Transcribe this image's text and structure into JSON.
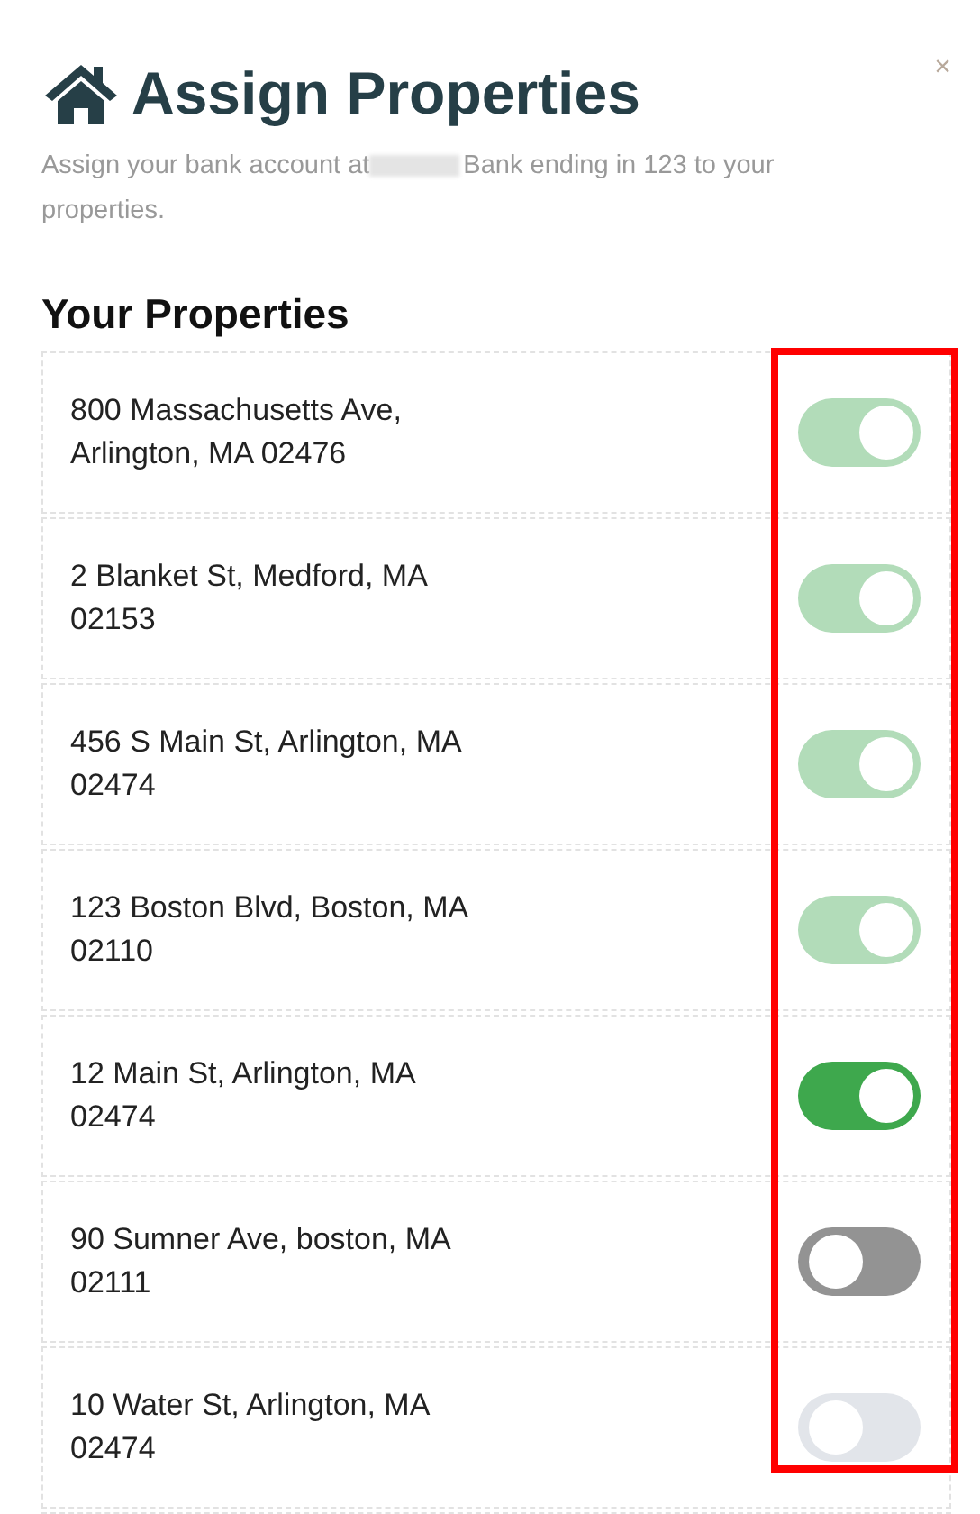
{
  "dialog": {
    "title": "Assign Properties",
    "close": "×",
    "subtitle_before": "Assign your bank account at",
    "subtitle_after": "Bank ending in 123 to your",
    "subtitle_end": "properties.",
    "redacted": true
  },
  "section_title": "Your Properties",
  "properties": [
    {
      "address": "800 Massachusetts Ave, Arlington, MA 02476",
      "on": true,
      "disabled": true
    },
    {
      "address": "2 Blanket St, Medford, MA 02153",
      "on": true,
      "disabled": true
    },
    {
      "address": "456 S Main St, Arlington, MA 02474",
      "on": true,
      "disabled": true
    },
    {
      "address": "123 Boston Blvd, Boston, MA 02110",
      "on": true,
      "disabled": true
    },
    {
      "address": "12 Main St, Arlington, MA 02474",
      "on": true,
      "disabled": false
    },
    {
      "address": "90 Sumner Ave, boston, MA 02111",
      "on": false,
      "disabled": false
    },
    {
      "address": "10 Water St, Arlington, MA 02474",
      "on": false,
      "disabled": true
    }
  ],
  "annotation": {
    "kind": "frame"
  }
}
